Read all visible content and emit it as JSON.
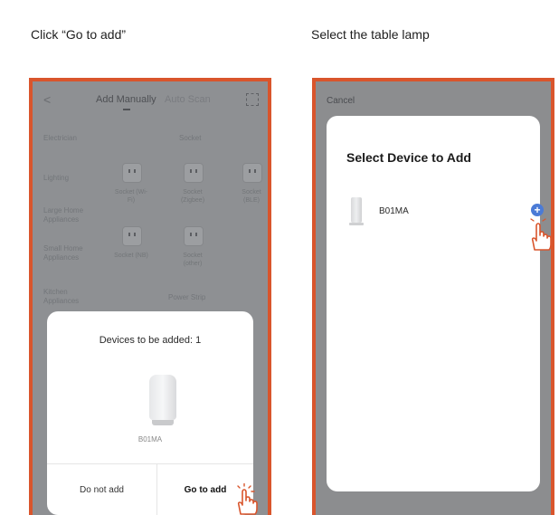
{
  "captions": {
    "left": "Click “Go to add”",
    "right": "Select the table lamp"
  },
  "left_phone": {
    "topbar": {
      "back": "<",
      "tab_active": "Add Manually",
      "tab_inactive": "Auto Scan"
    },
    "categories": [
      "Electrician",
      "Lighting",
      "Large Home Appliances",
      "Small Home Appliances",
      "Kitchen Appliances"
    ],
    "section_socket": "Socket",
    "section_power_strip": "Power Strip",
    "plugs": [
      {
        "label": "Socket (Wi-Fi)"
      },
      {
        "label": "Socket (Zigbee)"
      },
      {
        "label": "Socket (BLE)"
      },
      {
        "label": "Socket (NB)"
      },
      {
        "label": "Socket (other)"
      }
    ],
    "sheet": {
      "title": "Devices to be added: 1",
      "device_label": "B01MA",
      "btn_no": "Do not add",
      "btn_go": "Go to add"
    }
  },
  "right_phone": {
    "cancel": "Cancel",
    "title": "Select Device to Add",
    "device_name": "B01MA"
  },
  "colors": {
    "frame": "#d9552c",
    "accent_blue": "#4b7bd6",
    "hand_stroke": "#d9552c"
  }
}
